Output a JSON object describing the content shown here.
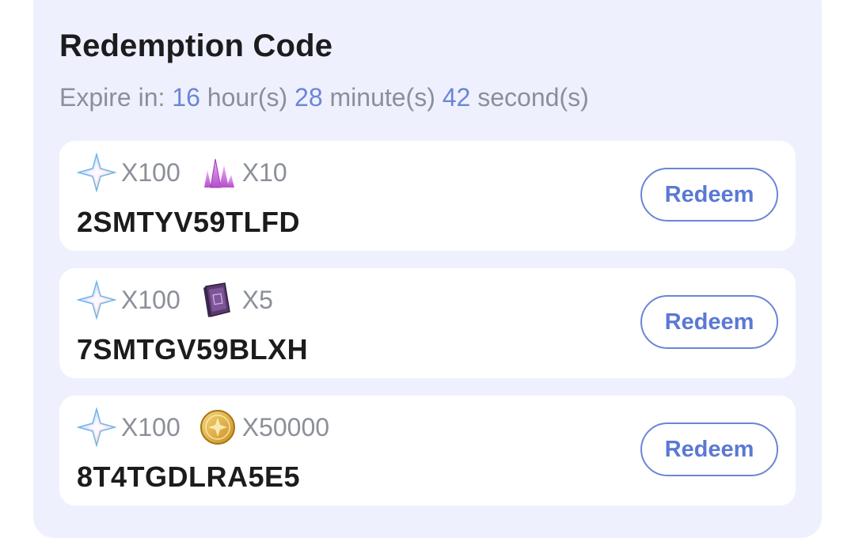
{
  "header": {
    "title": "Redemption Code",
    "expire_prefix": "Expire in:",
    "hours": "16",
    "hours_unit": "hour(s)",
    "minutes": "28",
    "minutes_unit": "minute(s)",
    "seconds": "42",
    "seconds_unit": "second(s)"
  },
  "accent_color": "#6b85d6",
  "codes": [
    {
      "code": "2SMTYV59TLFD",
      "button_label": "Redeem",
      "rewards": [
        {
          "icon": "primogem-icon",
          "count": "X100"
        },
        {
          "icon": "crystal-icon",
          "count": "X10"
        }
      ]
    },
    {
      "code": "7SMTGV59BLXH",
      "button_label": "Redeem",
      "rewards": [
        {
          "icon": "primogem-icon",
          "count": "X100"
        },
        {
          "icon": "book-icon",
          "count": "X5"
        }
      ]
    },
    {
      "code": "8T4TGDLRA5E5",
      "button_label": "Redeem",
      "rewards": [
        {
          "icon": "primogem-icon",
          "count": "X100"
        },
        {
          "icon": "coin-icon",
          "count": "X50000"
        }
      ]
    }
  ]
}
